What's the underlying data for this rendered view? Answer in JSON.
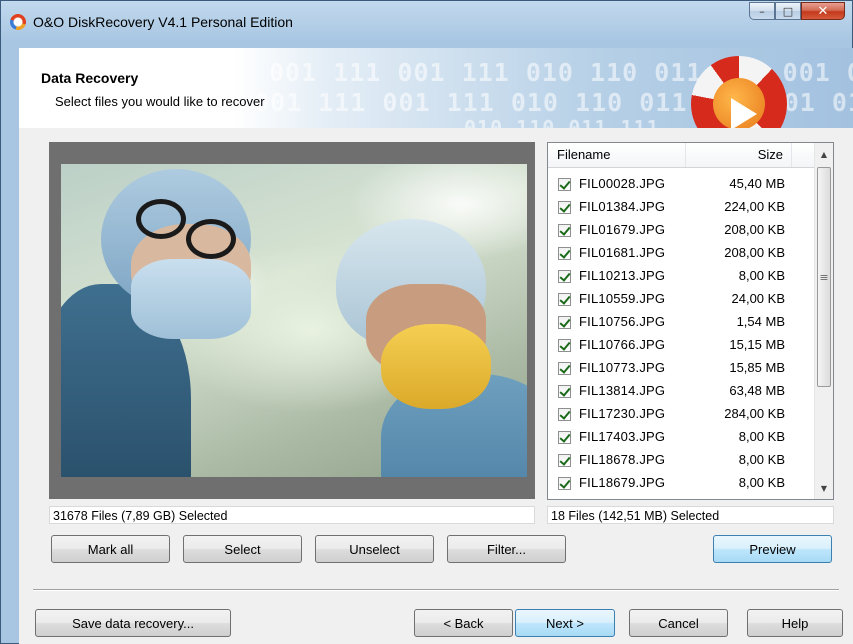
{
  "window": {
    "title": "O&O DiskRecovery V4.1 Personal Edition",
    "controls": {
      "minimize": "–",
      "maximize": "□",
      "close": "✕"
    }
  },
  "header": {
    "title": "Data Recovery",
    "subtitle": "Select files you would like to recover",
    "binary_line1": "001 111 001 111 010 110 011 111 001 010",
    "binary_line2": "001 111 001 111 010 110 011 111 001 010 0",
    "binary_line3": "010 110 011 111"
  },
  "file_list": {
    "columns": {
      "name": "Filename",
      "size": "Size"
    },
    "rows": [
      {
        "name": "FIL00028.JPG",
        "size": "45,40 MB",
        "checked": true
      },
      {
        "name": "FIL01384.JPG",
        "size": "224,00 KB",
        "checked": true
      },
      {
        "name": "FIL01679.JPG",
        "size": "208,00 KB",
        "checked": true
      },
      {
        "name": "FIL01681.JPG",
        "size": "208,00 KB",
        "checked": true
      },
      {
        "name": "FIL10213.JPG",
        "size": "8,00 KB",
        "checked": true
      },
      {
        "name": "FIL10559.JPG",
        "size": "24,00 KB",
        "checked": true
      },
      {
        "name": "FIL10756.JPG",
        "size": "1,54 MB",
        "checked": true
      },
      {
        "name": "FIL10766.JPG",
        "size": "15,15 MB",
        "checked": true
      },
      {
        "name": "FIL10773.JPG",
        "size": "15,85 MB",
        "checked": true
      },
      {
        "name": "FIL13814.JPG",
        "size": "63,48 MB",
        "checked": true
      },
      {
        "name": "FIL17230.JPG",
        "size": "284,00 KB",
        "checked": true
      },
      {
        "name": "FIL17403.JPG",
        "size": "8,00 KB",
        "checked": true
      },
      {
        "name": "FIL18678.JPG",
        "size": "8,00 KB",
        "checked": true
      },
      {
        "name": "FIL18679.JPG",
        "size": "8,00 KB",
        "checked": true
      }
    ],
    "scroll": {
      "up": "▲",
      "down": "▼",
      "grip": "≡"
    }
  },
  "status": {
    "left": "31678 Files (7,89 GB) Selected",
    "right": "18 Files (142,51 MB) Selected"
  },
  "buttons": {
    "mark_all": "Mark all",
    "select": "Select",
    "unselect": "Unselect",
    "filter": "Filter...",
    "preview": "Preview",
    "save": "Save data recovery...",
    "back": "< Back",
    "next": "Next >",
    "cancel": "Cancel",
    "help": "Help"
  }
}
